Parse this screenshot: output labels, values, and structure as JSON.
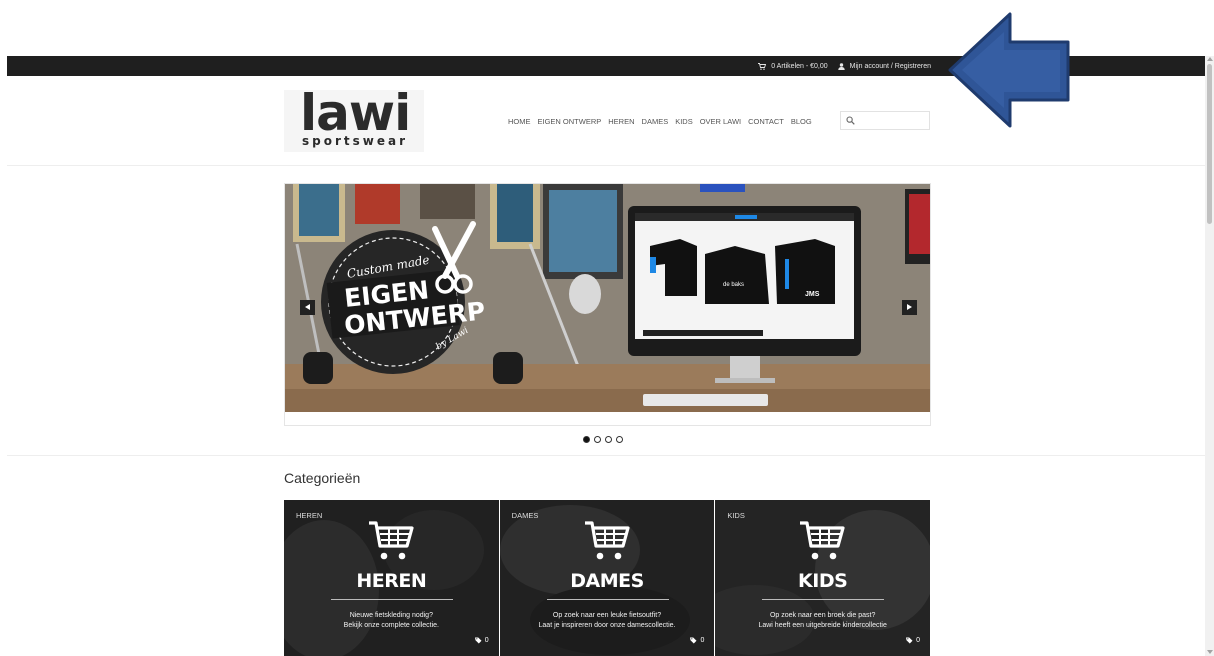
{
  "topbar": {
    "cart_text": "0 Artikelen - €0,00",
    "account_text": "Mijn account / Registreren"
  },
  "logo": {
    "word": "lawi",
    "sub": "sportswear"
  },
  "nav": {
    "items": [
      "HOME",
      "EIGEN ONTWERP",
      "HEREN",
      "DAMES",
      "KIDS",
      "OVER LAWI",
      "CONTACT",
      "BLOG"
    ]
  },
  "search": {
    "placeholder": ""
  },
  "slider": {
    "badge_script_top": "Custom made",
    "badge_line1": "EIGEN",
    "badge_line2": "ONTWERP",
    "badge_script_bottom": "by Lawi",
    "jersey_label": "de baks",
    "jersey_label2": "JMS",
    "dots_total": 4,
    "active_dot": 0
  },
  "categories": {
    "heading": "Categorieën",
    "items": [
      {
        "tag": "HEREN",
        "title": "HEREN",
        "desc1": "Nieuwe fietskleding nodig?",
        "desc2": "Bekijk onze complete collectie.",
        "count": "0"
      },
      {
        "tag": "DAMES",
        "title": "DAMES",
        "desc1": "Op zoek naar een leuke fietsoutfit?",
        "desc2": "Laat je inspireren door onze damescollectie.",
        "count": "0"
      },
      {
        "tag": "KIDS",
        "title": "KIDS",
        "desc1": "Op zoek naar een broek die past?",
        "desc2": "Lawi heeft een uitgebreide kindercollectie",
        "count": "0"
      }
    ]
  },
  "colors": {
    "annotation_arrow": "#2f5597",
    "topbar": "#1f1f1f"
  }
}
